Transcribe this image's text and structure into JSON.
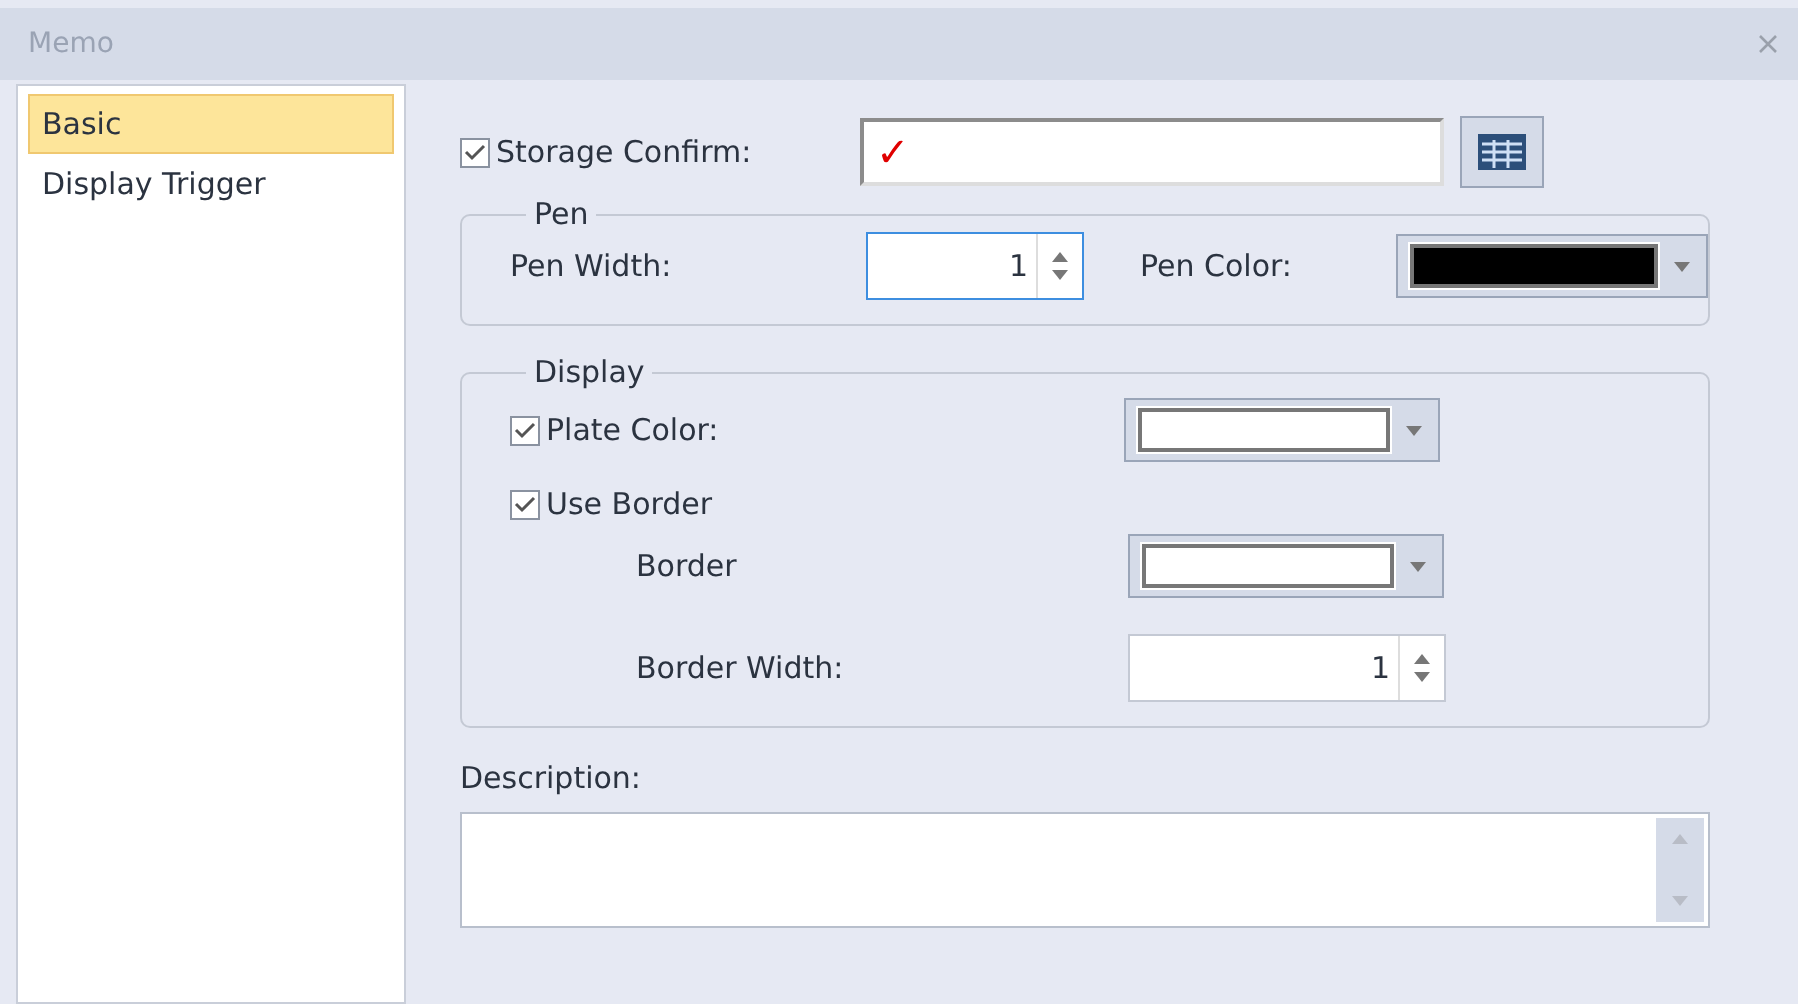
{
  "window": {
    "title": "Memo"
  },
  "sidebar": {
    "items": [
      {
        "label": "Basic",
        "selected": true
      },
      {
        "label": "Display Trigger",
        "selected": false
      }
    ]
  },
  "storage_confirm": {
    "label": "Storage Confirm:",
    "checked": true,
    "value": "✓"
  },
  "pen": {
    "title": "Pen",
    "width_label": "Pen Width:",
    "width_value": "1",
    "color_label": "Pen Color:",
    "color": "#000000"
  },
  "display": {
    "title": "Display",
    "plate_color": {
      "label": "Plate Color:",
      "checked": true,
      "color": "#ffffff"
    },
    "use_border": {
      "label": "Use Border",
      "checked": true
    },
    "border": {
      "label": "Border",
      "color": "#ffffff"
    },
    "border_width": {
      "label": "Border Width:",
      "value": "1"
    }
  },
  "description": {
    "label": "Description:"
  }
}
